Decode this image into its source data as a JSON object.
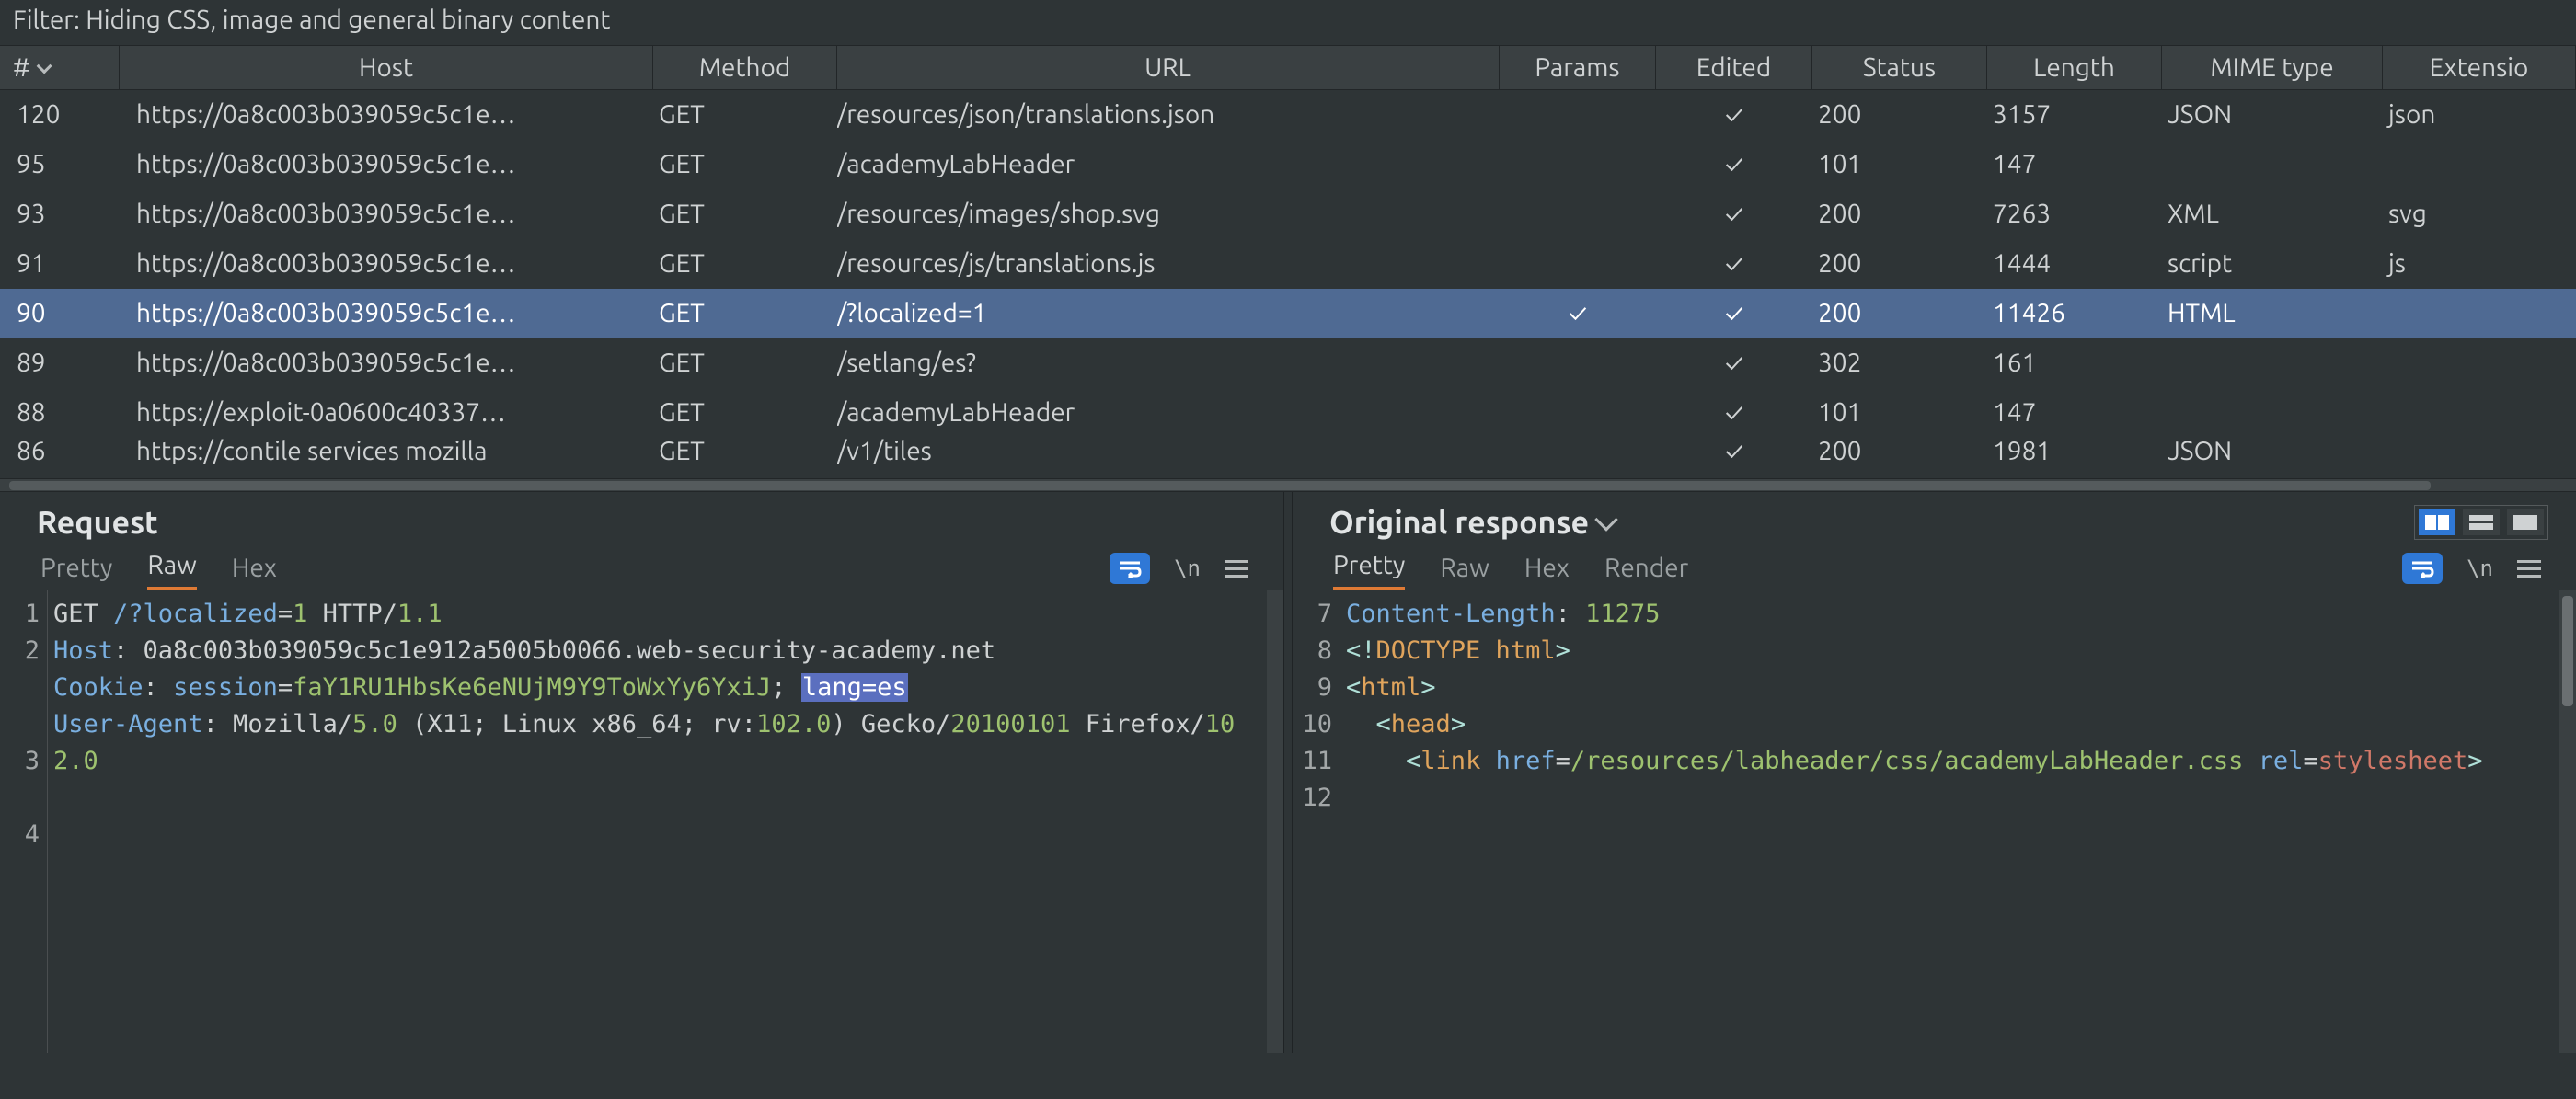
{
  "filter_text": "Filter: Hiding CSS, image and general binary content",
  "check": "✓",
  "columns": {
    "num": "#",
    "host": "Host",
    "method": "Method",
    "url": "URL",
    "params": "Params",
    "edited": "Edited",
    "status": "Status",
    "length": "Length",
    "mime": "MIME type",
    "ext": "Extensio"
  },
  "rows": [
    {
      "n": "120",
      "host": "https://0a8c003b039059c5c1e…",
      "method": "GET",
      "url": "/resources/json/translations.json",
      "params": "",
      "edited": "✓",
      "status": "200",
      "len": "3157",
      "mime": "JSON",
      "ext": "json",
      "sel": false
    },
    {
      "n": "95",
      "host": "https://0a8c003b039059c5c1e…",
      "method": "GET",
      "url": "/academyLabHeader",
      "params": "",
      "edited": "✓",
      "status": "101",
      "len": "147",
      "mime": "",
      "ext": "",
      "sel": false
    },
    {
      "n": "93",
      "host": "https://0a8c003b039059c5c1e…",
      "method": "GET",
      "url": "/resources/images/shop.svg",
      "params": "",
      "edited": "✓",
      "status": "200",
      "len": "7263",
      "mime": "XML",
      "ext": "svg",
      "sel": false
    },
    {
      "n": "91",
      "host": "https://0a8c003b039059c5c1e…",
      "method": "GET",
      "url": "/resources/js/translations.js",
      "params": "",
      "edited": "✓",
      "status": "200",
      "len": "1444",
      "mime": "script",
      "ext": "js",
      "sel": false
    },
    {
      "n": "90",
      "host": "https://0a8c003b039059c5c1e…",
      "method": "GET",
      "url": "/?localized=1",
      "params": "✓",
      "edited": "✓",
      "status": "200",
      "len": "11426",
      "mime": "HTML",
      "ext": "",
      "sel": true
    },
    {
      "n": "89",
      "host": "https://0a8c003b039059c5c1e…",
      "method": "GET",
      "url": "/setlang/es?",
      "params": "",
      "edited": "✓",
      "status": "302",
      "len": "161",
      "mime": "",
      "ext": "",
      "sel": false
    },
    {
      "n": "88",
      "host": "https://exploit-0a0600c40337…",
      "method": "GET",
      "url": "/academyLabHeader",
      "params": "",
      "edited": "✓",
      "status": "101",
      "len": "147",
      "mime": "",
      "ext": "",
      "sel": false
    },
    {
      "n": "86",
      "host": "https://contile services mozilla",
      "method": "GET",
      "url": "/v1/tiles",
      "params": "",
      "edited": "✓",
      "status": "200",
      "len": "1981",
      "mime": "JSON",
      "ext": "",
      "sel": false,
      "half": true
    }
  ],
  "request": {
    "title": "Request",
    "tabs": {
      "pretty": "Pretty",
      "raw": "Raw",
      "hex": "Hex"
    },
    "raw_lines": [
      {
        "n": "1",
        "parts": [
          {
            "t": "GET ",
            "cls": ""
          },
          {
            "t": "/?localized",
            "cls": "c-blue"
          },
          {
            "t": "=",
            "cls": ""
          },
          {
            "t": "1",
            "cls": "c-green"
          },
          {
            "t": " HTTP",
            "cls": ""
          },
          {
            "t": "/",
            "cls": ""
          },
          {
            "t": "1.1",
            "cls": "c-green"
          }
        ]
      },
      {
        "n": "2",
        "parts": [
          {
            "t": "Host",
            "cls": "c-blue"
          },
          {
            "t": ": ",
            "cls": ""
          },
          {
            "t": "0a8c003b039059c5c1e912a5005b0066.web-security-academy.net",
            "cls": "",
            "wrap": true
          }
        ]
      },
      {
        "n": "3",
        "parts": [
          {
            "t": "Cookie",
            "cls": "c-blue"
          },
          {
            "t": ": ",
            "cls": ""
          },
          {
            "t": "session",
            "cls": "c-blue"
          },
          {
            "t": "=",
            "cls": ""
          },
          {
            "t": "faY1RU1HbsKe6eNUjM9Y9ToWxYy6YxiJ",
            "cls": "c-green"
          },
          {
            "t": "; ",
            "cls": ""
          },
          {
            "t": "lang=es",
            "cls": "c-hl",
            "caret": true
          }
        ]
      },
      {
        "n": "4",
        "parts": [
          {
            "t": "User-Agent",
            "cls": "c-blue"
          },
          {
            "t": ": Mozilla",
            "cls": ""
          },
          {
            "t": "/",
            "cls": ""
          },
          {
            "t": "5.0",
            "cls": "c-green"
          },
          {
            "t": " (X11; Linux x86_64; rv:",
            "cls": ""
          },
          {
            "t": "102.0",
            "cls": "c-green"
          },
          {
            "t": ") Gecko",
            "cls": ""
          },
          {
            "t": "/",
            "cls": ""
          },
          {
            "t": "20100101",
            "cls": "c-green"
          },
          {
            "t": " Firefox",
            "cls": ""
          },
          {
            "t": "/",
            "cls": ""
          },
          {
            "t": "102.0",
            "cls": "c-green"
          }
        ]
      }
    ]
  },
  "response": {
    "title": "Original response",
    "tabs": {
      "pretty": "Pretty",
      "raw": "Raw",
      "hex": "Hex",
      "render": "Render"
    },
    "raw_lines": [
      {
        "n": "7",
        "parts": [
          {
            "t": "Content-Length",
            "cls": "c-blue"
          },
          {
            "t": ": ",
            "cls": ""
          },
          {
            "t": "11275",
            "cls": "c-green"
          }
        ]
      },
      {
        "n": "8",
        "parts": [
          {
            "t": "",
            "cls": ""
          }
        ]
      },
      {
        "n": "9",
        "parts": [
          {
            "t": "<!",
            "cls": "c-teal"
          },
          {
            "t": "DOCTYPE html",
            "cls": "c-orange"
          },
          {
            "t": ">",
            "cls": "c-teal"
          }
        ]
      },
      {
        "n": "10",
        "parts": [
          {
            "t": "<",
            "cls": "c-teal"
          },
          {
            "t": "html",
            "cls": "c-orange"
          },
          {
            "t": ">",
            "cls": "c-teal"
          }
        ]
      },
      {
        "n": "11",
        "parts": [
          {
            "t": "  ",
            "cls": ""
          },
          {
            "t": "<",
            "cls": "c-teal"
          },
          {
            "t": "head",
            "cls": "c-orange"
          },
          {
            "t": ">",
            "cls": "c-teal"
          }
        ]
      },
      {
        "n": "12",
        "parts": [
          {
            "t": "    ",
            "cls": ""
          },
          {
            "t": "<",
            "cls": "c-teal"
          },
          {
            "t": "link",
            "cls": "c-orange"
          },
          {
            "t": " ",
            "cls": ""
          },
          {
            "t": "href",
            "cls": "c-blue"
          },
          {
            "t": "=",
            "cls": ""
          },
          {
            "t": "/resources/labheader/css/academyLabHeader.css",
            "cls": "c-green",
            "wrap": true
          },
          {
            "t": " ",
            "cls": ""
          },
          {
            "t": "rel",
            "cls": "c-blue"
          },
          {
            "t": "=",
            "cls": ""
          },
          {
            "t": "stylesheet",
            "cls": "c-red"
          },
          {
            "t": ">",
            "cls": "c-teal"
          }
        ]
      }
    ]
  },
  "toolstrip": {
    "ln_label": "\\n"
  }
}
